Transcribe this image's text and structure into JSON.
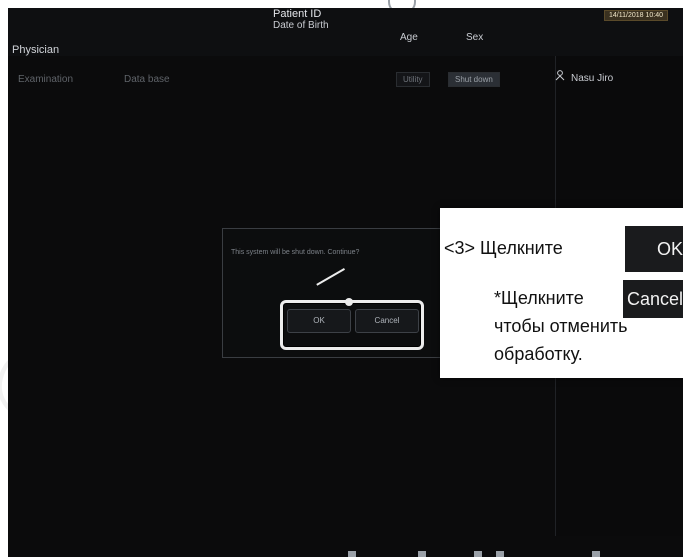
{
  "header": {
    "physician_label": "Physician",
    "patient_id_label": "Patient ID",
    "dob_label": "Date of Birth",
    "age_label": "Age",
    "sex_label": "Sex",
    "datetime": "14/11/2018 10:40"
  },
  "tabs": [
    {
      "label": "Examination"
    },
    {
      "label": "Data base"
    }
  ],
  "toolbar": {
    "utility_label": "Utility",
    "shutdown_label": "Shut down"
  },
  "user": {
    "name": "Nasu Jiro"
  },
  "dialog": {
    "message": "This system will be shut down. Continue?",
    "ok_label": "OK",
    "cancel_label": "Cancel"
  },
  "callout": {
    "line1": "<3> Щелкните",
    "button1_label": "OK",
    "line2": "*Щелкните",
    "button2_label": "Cancel",
    "line3": "чтобы отменить",
    "line4": "обработку."
  }
}
